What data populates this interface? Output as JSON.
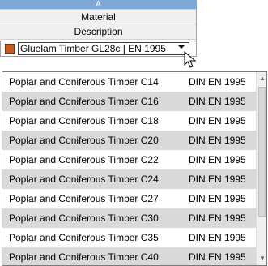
{
  "column": {
    "letter": "A"
  },
  "header": {
    "material": "Material",
    "description": "Description"
  },
  "combo": {
    "value": "Gluelam Timber GL28c | EN 1995",
    "swatch_color": "#c85a1e"
  },
  "dropdown": {
    "items": [
      {
        "name": "Poplar and Coniferous Timber C14",
        "standard": "DIN EN 1995"
      },
      {
        "name": "Poplar and Coniferous Timber C16",
        "standard": "DIN EN 1995"
      },
      {
        "name": "Poplar and Coniferous Timber C18",
        "standard": "DIN EN 1995"
      },
      {
        "name": "Poplar and Coniferous Timber C20",
        "standard": "DIN EN 1995"
      },
      {
        "name": "Poplar and Coniferous Timber C22",
        "standard": "DIN EN 1995"
      },
      {
        "name": "Poplar and Coniferous Timber C24",
        "standard": "DIN EN 1995"
      },
      {
        "name": "Poplar and Coniferous Timber C27",
        "standard": "DIN EN 1995"
      },
      {
        "name": "Poplar and Coniferous Timber C30",
        "standard": "DIN EN 1995"
      },
      {
        "name": "Poplar and Coniferous Timber C35",
        "standard": "DIN EN 1995"
      },
      {
        "name": "Poplar and Coniferous Timber C40",
        "standard": "DIN EN 1995"
      }
    ]
  },
  "icons": {
    "dropdown_arrow": "chevron-down-icon",
    "scroll_up": "scroll-up-icon",
    "scroll_down": "scroll-down-icon",
    "cursor": "mouse-pointer-icon"
  }
}
